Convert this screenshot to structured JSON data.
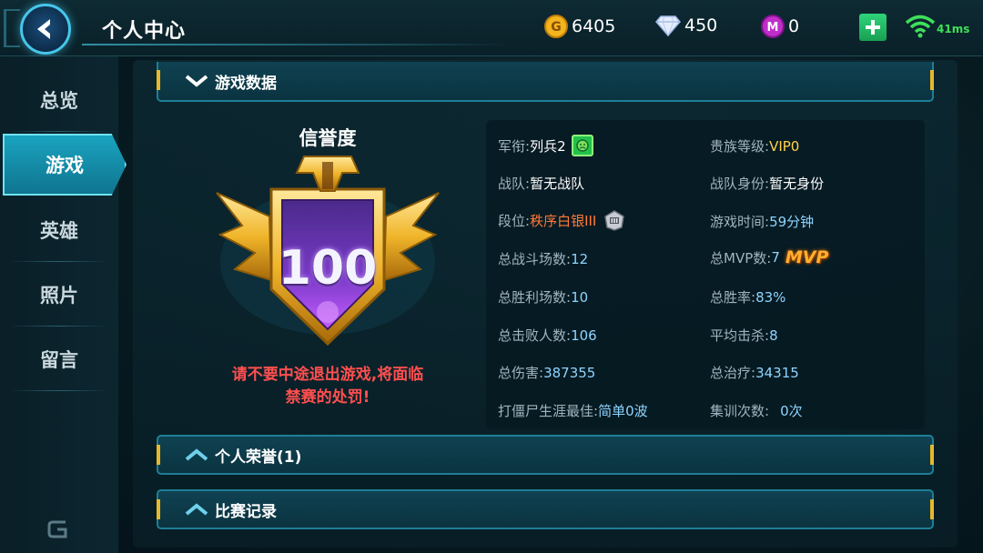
{
  "header": {
    "title": "个人中心",
    "gold": "6405",
    "diamond": "450",
    "crystal": "0",
    "ping": "41ms"
  },
  "sidebar": {
    "items": [
      {
        "label": "总览",
        "active": false
      },
      {
        "label": "游戏",
        "active": true
      },
      {
        "label": "英雄",
        "active": false
      },
      {
        "label": "照片",
        "active": false
      },
      {
        "label": "留言",
        "active": false
      }
    ]
  },
  "sections": {
    "game_data": "游戏数据",
    "honor": "个人荣誉(1)",
    "record": "比赛记录"
  },
  "credit": {
    "title": "信誉度",
    "score": "100",
    "warning_line1": "请不要中途退出游戏,将面临",
    "warning_line2": "禁赛的处罚!"
  },
  "stats": {
    "rank": {
      "label": "军衔: ",
      "value": "列兵2"
    },
    "noble": {
      "label": "贵族等级: ",
      "value": "VIP0"
    },
    "team": {
      "label": "战队: ",
      "value": "暂无战队"
    },
    "team_role": {
      "label": "战队身份: ",
      "value": "暂无身份"
    },
    "tier": {
      "label": "段位: ",
      "value": "秩序白银III"
    },
    "play_time": {
      "label": "游戏时间: ",
      "value": "59分钟"
    },
    "total_matches": {
      "label": "总战斗场数: ",
      "value": "12"
    },
    "total_mvp": {
      "label": "总MVP数: ",
      "value": "7",
      "badge": "MVP"
    },
    "total_wins": {
      "label": "总胜利场数: ",
      "value": "10"
    },
    "win_rate": {
      "label": "总胜率: ",
      "value": "83%"
    },
    "total_kills": {
      "label": "总击败人数: ",
      "value": "106"
    },
    "avg_kills": {
      "label": "平均击杀: ",
      "value": "8"
    },
    "total_damage": {
      "label": "总伤害: ",
      "value": "387355"
    },
    "total_heal": {
      "label": "总治疗: ",
      "value": "34315"
    },
    "zombie_best": {
      "label": "打僵尸生涯最佳: ",
      "value": "简单0波"
    },
    "training_count": {
      "label": "集训次数: ",
      "value": "0次"
    }
  },
  "colors": {
    "accent": "#1aa3bf",
    "warning": "#ff4f4f",
    "tier": "#ff7a3a",
    "vip": "#ffd54a",
    "ping": "#3ee05a"
  }
}
